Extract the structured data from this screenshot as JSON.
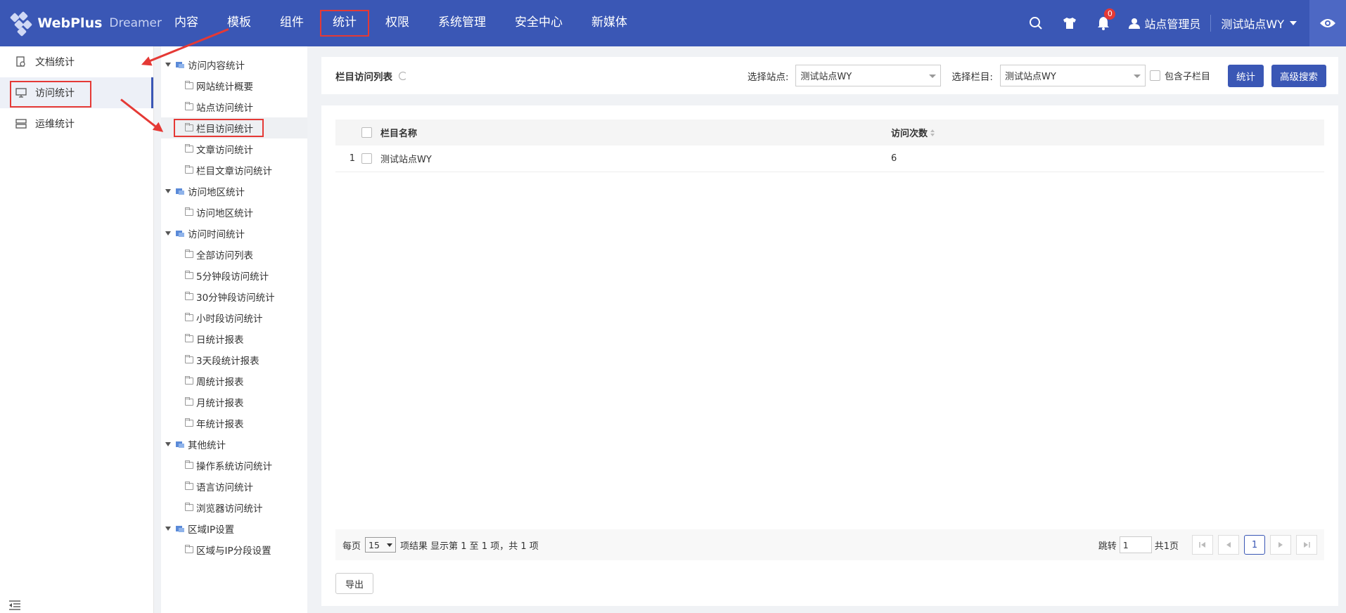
{
  "app": {
    "logo_text": "WebPlus",
    "logo_sub": "Dreamer"
  },
  "nav": [
    "内容",
    "模板",
    "组件",
    "统计",
    "权限",
    "系统管理",
    "安全中心",
    "新媒体"
  ],
  "nav_active": "统计",
  "top": {
    "notification_count": "0",
    "user_name": "站点管理员",
    "site_name": "测试站点WY"
  },
  "side1": [
    "文档统计",
    "访问统计",
    "运维统计"
  ],
  "tree": {
    "g1": "访问内容统计",
    "g1_items": [
      "网站统计概要",
      "站点访问统计",
      "栏目访问统计",
      "文章访问统计",
      "栏目文章访问统计"
    ],
    "g2": "访问地区统计",
    "g2_items": [
      "访问地区统计"
    ],
    "g3": "访问时间统计",
    "g3_items": [
      "全部访问列表",
      "5分钟段访问统计",
      "30分钟段访问统计",
      "小时段访问统计",
      "日统计报表",
      "3天段统计报表",
      "周统计报表",
      "月统计报表",
      "年统计报表"
    ],
    "g4": "其他统计",
    "g4_items": [
      "操作系统访问统计",
      "语言访问统计",
      "浏览器访问统计"
    ],
    "g5": "区域IP设置",
    "g5_items": [
      "区域与IP分段设置"
    ]
  },
  "main": {
    "title": "栏目访问列表",
    "site_label": "选择站点:",
    "site_value": "测试站点WY",
    "column_label": "选择栏目:",
    "column_value": "测试站点WY",
    "include_sub": "包含子栏目",
    "stat_btn": "统计",
    "adv_btn": "高级搜索",
    "table": {
      "headers": {
        "name": "栏目名称",
        "count": "访问次数"
      },
      "rows": [
        {
          "idx": "1",
          "name": "测试站点WY",
          "count": "6"
        }
      ]
    },
    "pager": {
      "per_page_label": "每页",
      "per_page": "15",
      "summary": "项结果 显示第 1 至 1 项，共 1 项",
      "jump_label": "跳转",
      "jump_value": "1",
      "total_pages": "共1页",
      "current": "1"
    },
    "export_btn": "导出"
  },
  "colors": {
    "brand": "#3a57b5",
    "highlight": "#e53935"
  }
}
